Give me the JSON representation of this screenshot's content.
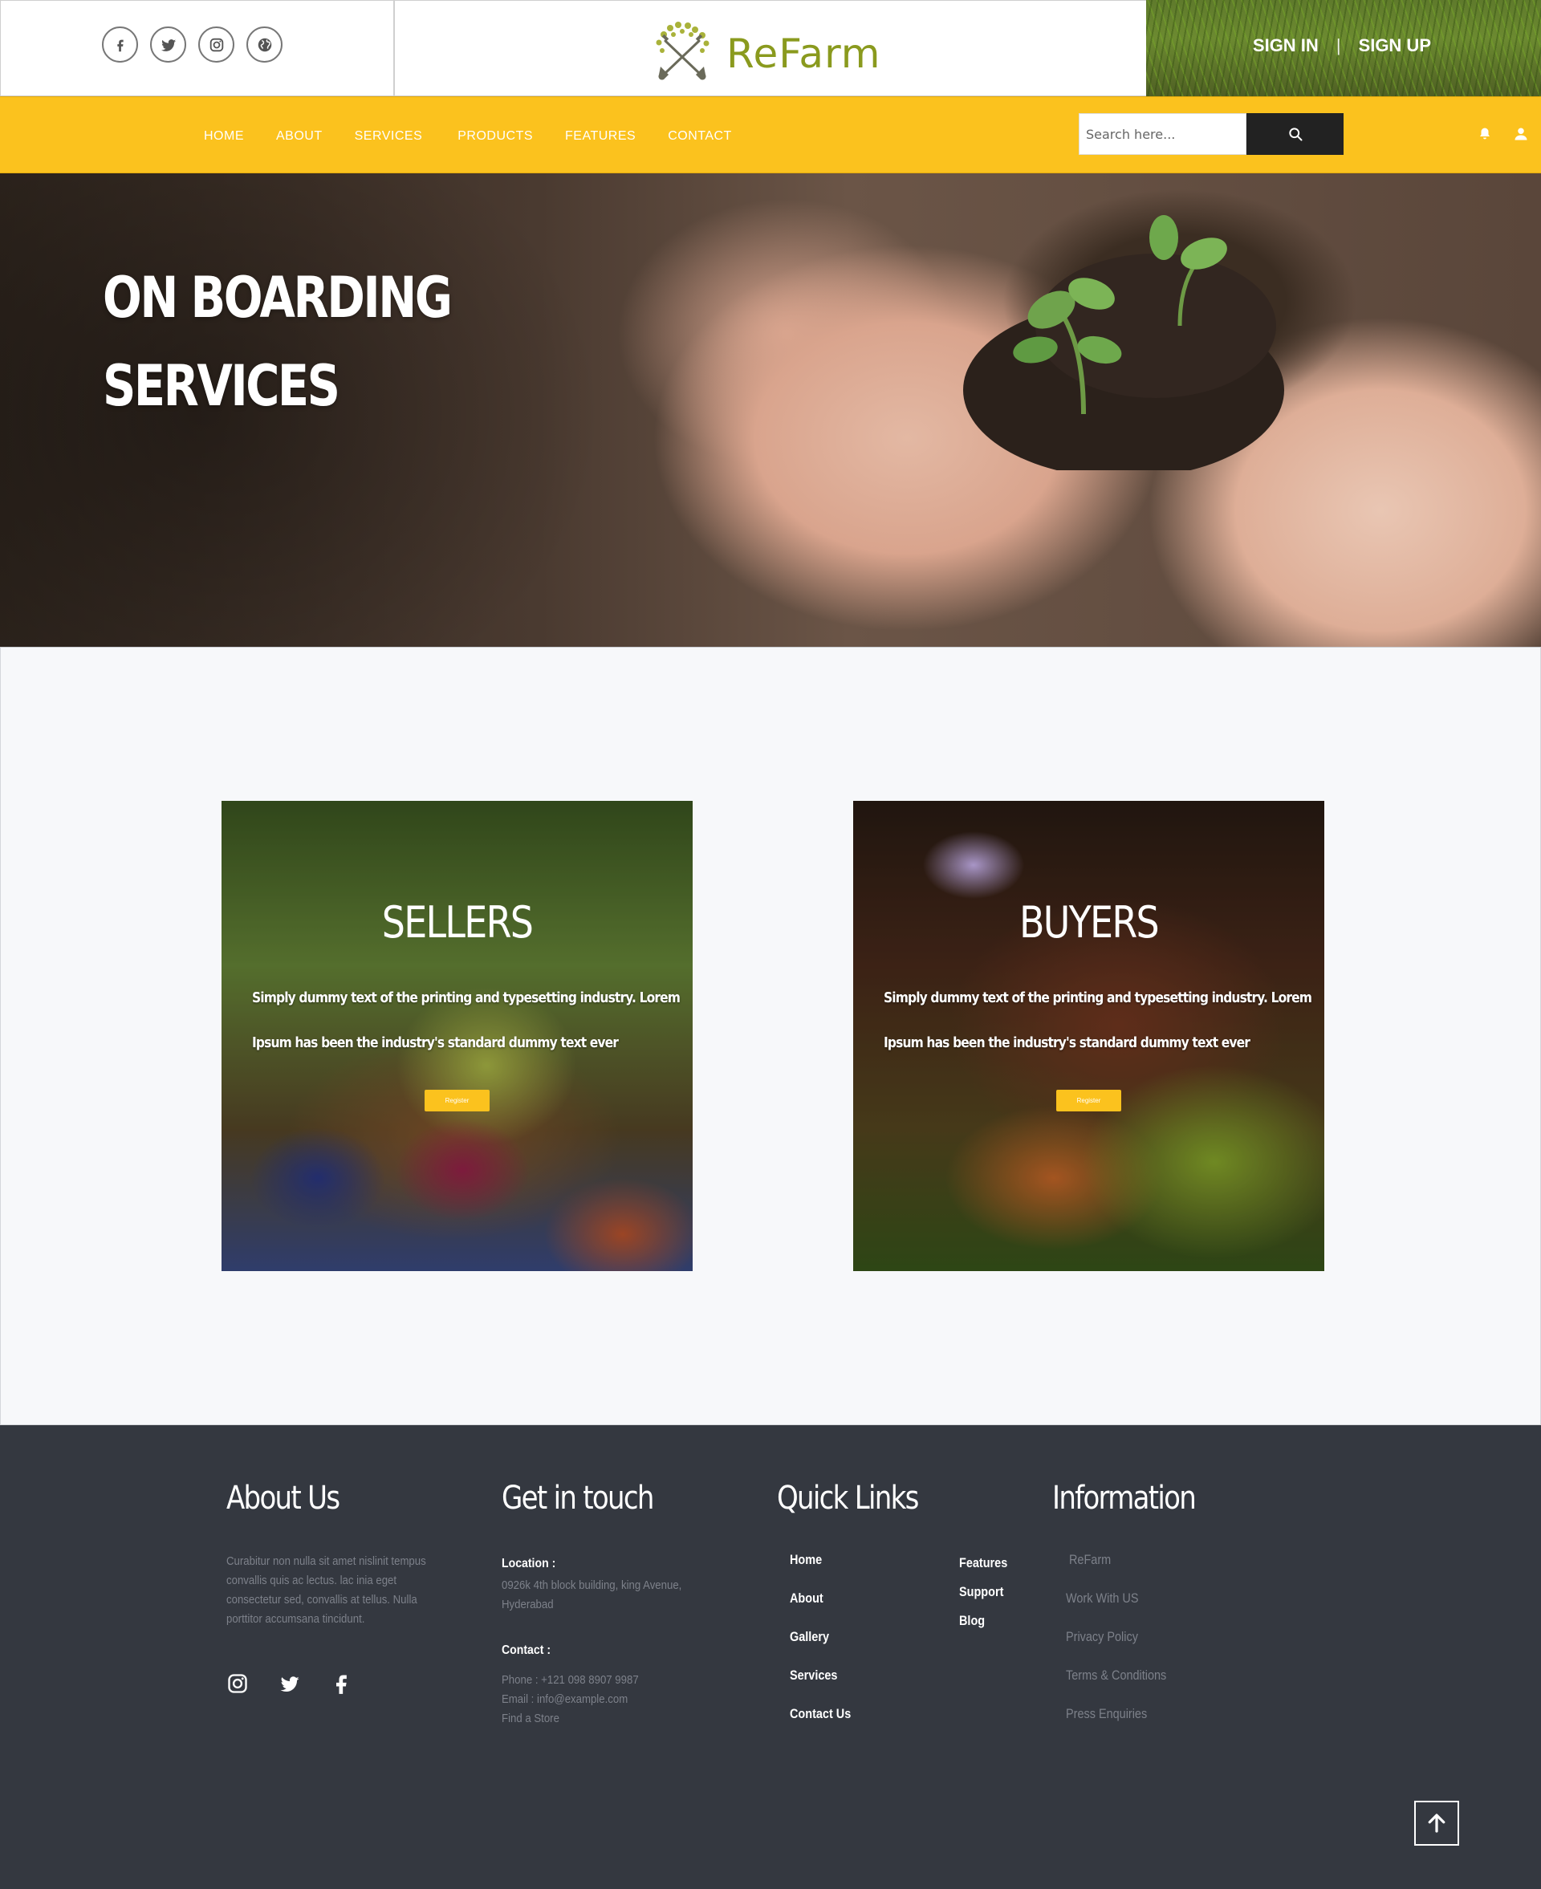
{
  "brand": {
    "name": "ReFarm",
    "logo_color": "#8a9a1e"
  },
  "topbar": {
    "social": [
      {
        "icon": "facebook-icon"
      },
      {
        "icon": "twitter-icon"
      },
      {
        "icon": "instagram-icon"
      },
      {
        "icon": "globe-icon"
      }
    ],
    "sign_in": "SIGN IN",
    "separator": "|",
    "sign_up": "SIGN UP"
  },
  "nav": {
    "items": [
      "HOME",
      "ABOUT",
      "SERVICES",
      "PRODUCTS",
      "FEATURES",
      "CONTACT"
    ],
    "search_placeholder": "Search here...",
    "accent": "#fbc21e"
  },
  "hero": {
    "title_line1": "ON BOARDING",
    "title_line2": "SERVICES"
  },
  "cards": [
    {
      "title": "SELLERS",
      "text_line1": "Simply dummy text of the printing and typesetting industry. Lorem",
      "text_line2": "Ipsum has been the industry's standard dummy text ever",
      "button": "Register"
    },
    {
      "title": "BUYERS",
      "text_line1": "Simply dummy text of the printing and typesetting industry. Lorem",
      "text_line2": "Ipsum has been the industry's standard dummy text ever",
      "button": "Register"
    }
  ],
  "footer": {
    "about": {
      "heading": "About Us",
      "text": "Curabitur non nulla sit amet nislinit tempus convallis quis ac lectus. lac inia eget consectetur sed, convallis at tellus. Nulla porttitor accumsana tincidunt."
    },
    "contact": {
      "heading": "Get in touch",
      "location_label": "Location :",
      "location_line1": "0926k 4th block building, king Avenue,",
      "location_line2": "Hyderabad",
      "contact_label": "Contact :",
      "phone": "Phone : +121 098 8907 9987",
      "email": "Email : info@example.com",
      "store": "Find a Store"
    },
    "quick_links": {
      "heading": "Quick Links",
      "col1": [
        "Home",
        "About",
        "Gallery",
        "Services",
        "Contact Us"
      ],
      "col2": [
        "Features",
        "Support",
        "Blog"
      ]
    },
    "information": {
      "heading": "Information",
      "items": [
        "ReFarm",
        "Work With US",
        "Privacy Policy",
        "Terms & Conditions",
        "Press Enquiries"
      ]
    }
  }
}
